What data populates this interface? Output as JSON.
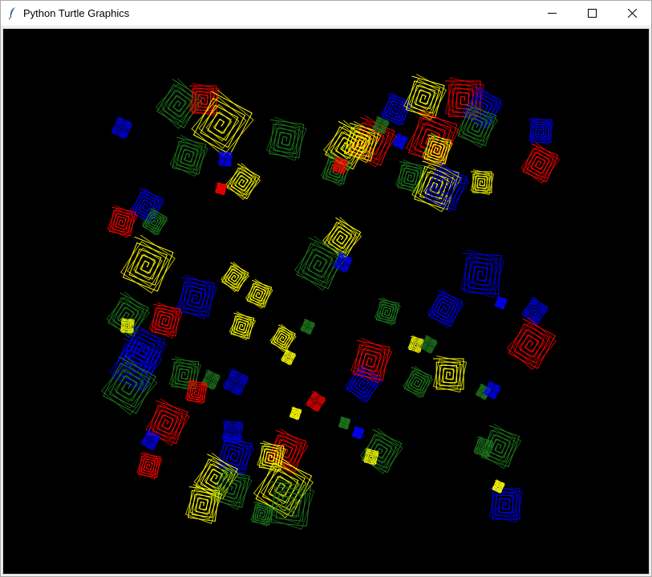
{
  "window": {
    "title": "Python Turtle Graphics",
    "icon": "feather-icon"
  },
  "controls": {
    "minimize": "minimize-icon",
    "maximize": "maximize-icon",
    "close": "close-icon"
  },
  "canvas": {
    "background": "#000000",
    "colors": {
      "red": "#ff0000",
      "yellow": "#ffff00",
      "green": "#1e7a1e",
      "blue": "#0000ff"
    },
    "shape": "square-spiral"
  }
}
